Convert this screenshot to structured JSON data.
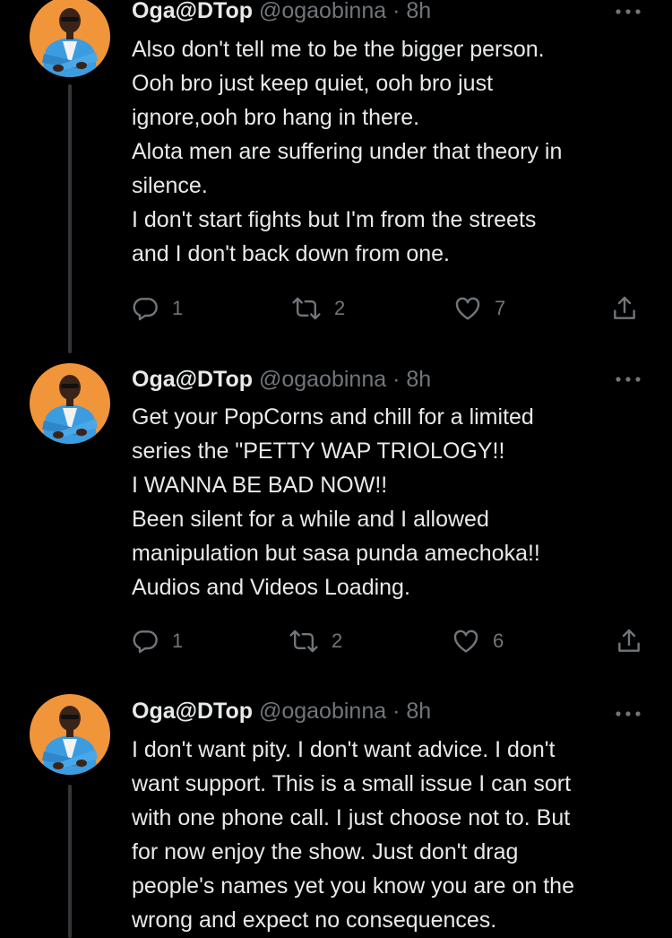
{
  "tweets": [
    {
      "name": "Oga@DTop",
      "handle": "@ogaobinna",
      "dot": "·",
      "time": "8h",
      "lines": [
        "Also don't tell me to be the bigger person.",
        "Ooh bro just keep quiet, ooh bro just",
        "ignore,ooh bro hang in there.",
        "Alota men are suffering under that theory in",
        "silence.",
        "I don't start fights but I'm from the streets",
        "and I don't back down from one."
      ],
      "replies": "1",
      "retweets": "2",
      "likes": "7"
    },
    {
      "name": "Oga@DTop",
      "handle": "@ogaobinna",
      "dot": "·",
      "time": "8h",
      "lines": [
        "Get your PopCorns and chill for a limited",
        "series the \"PETTY WAP TRIOLOGY!!",
        "I WANNA BE BAD NOW!!",
        "Been silent for a while and I allowed",
        "manipulation but sasa punda amechoka!!",
        "Audios and Videos Loading."
      ],
      "replies": "1",
      "retweets": "2",
      "likes": "6"
    },
    {
      "name": "Oga@DTop",
      "handle": "@ogaobinna",
      "dot": "·",
      "time": "8h",
      "lines": [
        "I don't want pity. I don't want advice.  I don't",
        "want support. This is a small issue I can sort",
        "with one phone call. I just choose not to. But",
        "for now enjoy the show. Just don't drag",
        "people's names yet you know you are on the",
        "wrong and expect no consequences."
      ]
    }
  ],
  "icons": {
    "reply": "reply-icon",
    "retweet": "retweet-icon",
    "like": "heart-icon",
    "share": "share-icon",
    "more": "more-icon",
    "avatar": "avatar"
  },
  "colors": {
    "background": "#000000",
    "text": "#e7e9ea",
    "muted": "#71767b",
    "thread_line": "#333639",
    "avatar_bg": "#f0953a",
    "jacket": "#3c9ce0"
  }
}
